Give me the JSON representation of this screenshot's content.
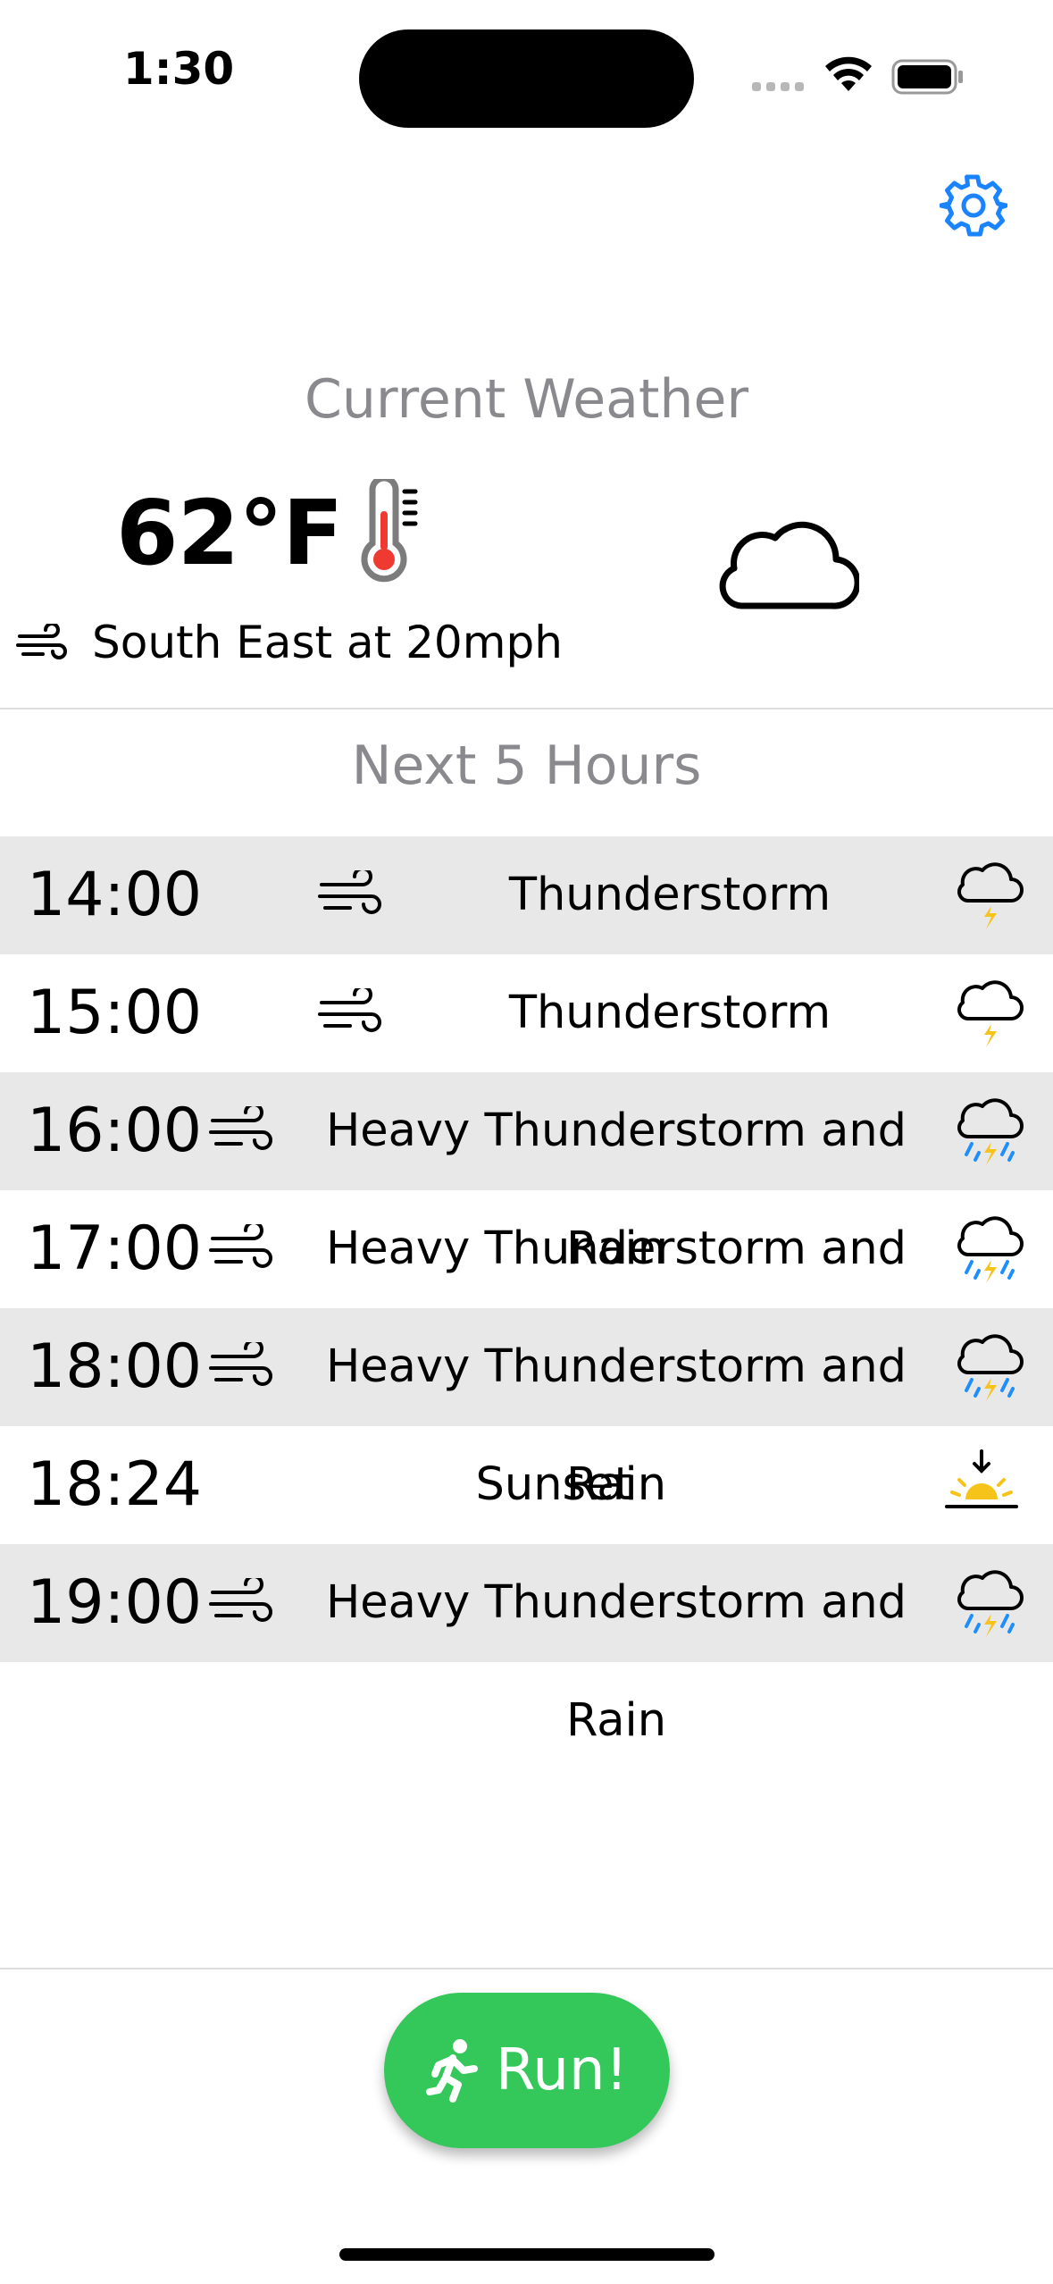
{
  "status_bar": {
    "time": "1:30"
  },
  "header": {
    "settings_icon": "gear-icon",
    "accent": "#1a84ff"
  },
  "current": {
    "title": "Current Weather",
    "temperature": "62°F",
    "wind": "South East at 20mph",
    "condition_icon": "cloud-icon"
  },
  "forecast": {
    "title": "Next 5 Hours",
    "rows": [
      {
        "time": "14:00",
        "condition": "Thunderstorm",
        "wind_icon": true,
        "icon": "thunderstorm-icon",
        "shaded": true
      },
      {
        "time": "15:00",
        "condition": "Thunderstorm",
        "wind_icon": true,
        "icon": "thunderstorm-icon",
        "shaded": false
      },
      {
        "time": "16:00",
        "condition": "Heavy Thunderstorm and Rain",
        "wind_icon": true,
        "icon": "thunderstorm-rain-icon",
        "shaded": true
      },
      {
        "time": "17:00",
        "condition": "Heavy Thunderstorm and Rain",
        "wind_icon": true,
        "icon": "thunderstorm-rain-icon",
        "shaded": false
      },
      {
        "time": "18:00",
        "condition": "Heavy Thunderstorm and Rain",
        "wind_icon": true,
        "icon": "thunderstorm-rain-icon",
        "shaded": true
      },
      {
        "time": "18:24",
        "condition": "Sunset",
        "wind_icon": false,
        "icon": "sunset-icon",
        "shaded": false
      },
      {
        "time": "19:00",
        "condition": "Heavy Thunderstorm and Rain",
        "wind_icon": true,
        "icon": "thunderstorm-rain-icon",
        "shaded": true
      }
    ]
  },
  "run_button": {
    "label": "Run!",
    "icon": "runner-icon",
    "color": "#34c75a"
  }
}
